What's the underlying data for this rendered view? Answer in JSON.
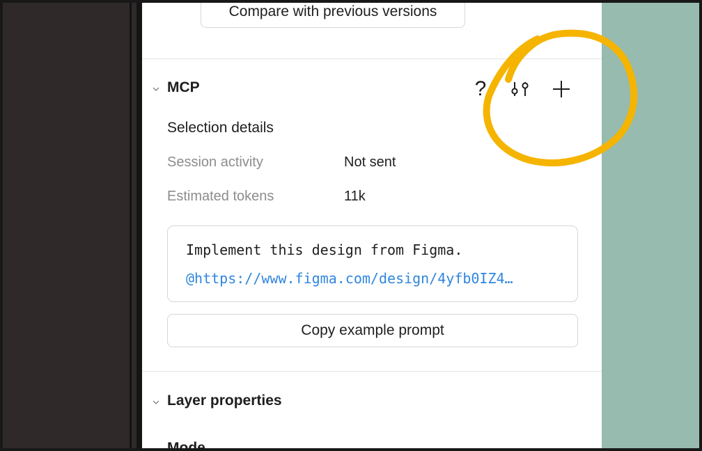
{
  "header": {
    "compare_label": "Compare with previous versions"
  },
  "mcp": {
    "title": "MCP",
    "help_glyph": "?",
    "selection_title": "Selection details",
    "rows": [
      {
        "label": "Session activity",
        "value": "Not sent"
      },
      {
        "label": "Estimated tokens",
        "value": "11k"
      }
    ],
    "prompt": {
      "line1": "Implement this design from Figma.",
      "line2": "@https://www.figma.com/design/4yfb0IZ4…"
    },
    "copy_label": "Copy example prompt"
  },
  "layer": {
    "title": "Layer properties",
    "next_label": "Mode"
  },
  "colors": {
    "accent": "#f5b400",
    "link": "#2f86df",
    "panel_bg": "#ffffff",
    "left_bg": "#2f2a29",
    "right_bg": "#97bbae"
  },
  "icons": [
    "chevron-down-icon",
    "help-icon",
    "settings-sliders-icon",
    "plus-icon"
  ]
}
